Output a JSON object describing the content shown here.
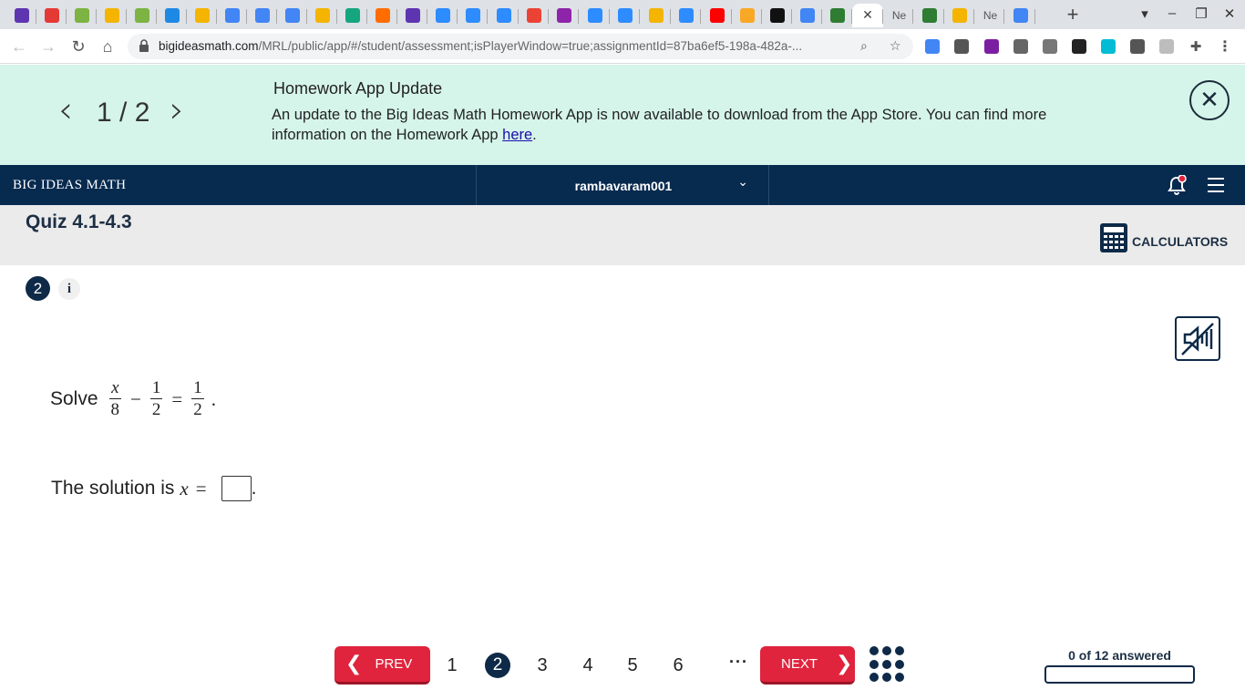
{
  "browser": {
    "tabs": [
      {
        "icon": "list-icon",
        "color": "#5e35b1",
        "label": ""
      },
      {
        "icon": "acrobat-icon",
        "color": "#e53935",
        "label": ""
      },
      {
        "icon": "ixl-icon",
        "color": "#7cb342",
        "label": ""
      },
      {
        "icon": "slides-icon",
        "color": "#f4b400",
        "label": ""
      },
      {
        "icon": "ixl-icon",
        "color": "#7cb342",
        "label": ""
      },
      {
        "icon": "classroom-icon",
        "color": "#1e88e5",
        "label": ""
      },
      {
        "icon": "slides-icon",
        "color": "#f4b400",
        "label": ""
      },
      {
        "icon": "docs-icon",
        "color": "#4285f4",
        "label": ""
      },
      {
        "icon": "docs-icon",
        "color": "#4285f4",
        "label": ""
      },
      {
        "icon": "docs-icon",
        "color": "#4285f4",
        "label": ""
      },
      {
        "icon": "slides-icon",
        "color": "#f4b400",
        "label": ""
      },
      {
        "icon": "grammarly-icon",
        "color": "#15a680",
        "label": ""
      },
      {
        "icon": "f-icon",
        "color": "#ff6d00",
        "label": ""
      },
      {
        "icon": "list-icon",
        "color": "#5e35b1",
        "label": ""
      },
      {
        "icon": "zoom-icon",
        "color": "#2d8cff",
        "label": ""
      },
      {
        "icon": "zoom-icon",
        "color": "#2d8cff",
        "label": ""
      },
      {
        "icon": "zoom-icon",
        "color": "#2d8cff",
        "label": ""
      },
      {
        "icon": "gmail-icon",
        "color": "#ea4335",
        "label": ""
      },
      {
        "icon": "pinwheel-icon",
        "color": "#8e24aa",
        "label": ""
      },
      {
        "icon": "zoom-icon",
        "color": "#2d8cff",
        "label": ""
      },
      {
        "icon": "zoom-icon",
        "color": "#2d8cff",
        "label": ""
      },
      {
        "icon": "classroom-icon",
        "color": "#f4b400",
        "label": ""
      },
      {
        "icon": "zoom-icon",
        "color": "#2d8cff",
        "label": ""
      },
      {
        "icon": "youtube-icon",
        "color": "#ff0000",
        "label": ""
      },
      {
        "icon": "pencil-icon",
        "color": "#f9a825",
        "label": ""
      },
      {
        "icon": "b-icon",
        "color": "#111111",
        "label": ""
      },
      {
        "icon": "google-icon",
        "color": "#4285f4",
        "label": ""
      },
      {
        "icon": "bim-icon",
        "color": "#2e7d32",
        "label": ""
      },
      {
        "icon": "close-icon",
        "color": "#444444",
        "label": ""
      },
      {
        "icon": "new-tab-icon",
        "color": "#9e9e9e",
        "label": "Ne"
      },
      {
        "icon": "bim-icon",
        "color": "#2e7d32",
        "label": ""
      },
      {
        "icon": "classroom-icon",
        "color": "#f4b400",
        "label": ""
      },
      {
        "icon": "new-tab-icon",
        "color": "#9e9e9e",
        "label": "Ne"
      },
      {
        "icon": "google-icon",
        "color": "#4285f4",
        "label": ""
      }
    ],
    "new_tab": "+",
    "url_host": "bigideasmath.com",
    "url_path": "/MRL/public/app/#/student/assessment;isPlayerWindow=true;assignmentId=87ba6ef5-198a-482a-...",
    "extensions": [
      {
        "icon": "translate-icon",
        "color": "#4285f4"
      },
      {
        "icon": "camera-icon",
        "color": "#555555"
      },
      {
        "icon": "puzzle-purple-icon",
        "color": "#7b1fa2"
      },
      {
        "icon": "draw-icon",
        "color": "#666666"
      },
      {
        "icon": "stack-icon",
        "color": "#777777"
      },
      {
        "icon": "spy-icon",
        "color": "#222222"
      },
      {
        "icon": "circle-ext-icon",
        "color": "#00bcd4"
      },
      {
        "icon": "l-icon",
        "color": "#555555"
      },
      {
        "icon": "b-ext-icon",
        "color": "#bdbdbd"
      },
      {
        "icon": "puzzle-icon",
        "color": "#555555"
      },
      {
        "icon": "more-icon",
        "color": "#555555"
      }
    ]
  },
  "banner": {
    "pager": "1 / 2",
    "title": "Homework App Update",
    "body": "An update to the Big Ideas Math Homework App is now available to download from the App Store. You can find more information on the Homework App ",
    "link": "here",
    "tail": ".",
    "bg": "#d6f5ea"
  },
  "appbar": {
    "brand": "BIG IDEAS MATH",
    "username": "rambavaram001",
    "bg": "#072a4f",
    "notification_dot": "#e0243d"
  },
  "quiz": {
    "title": "Quiz 4.1-4.3",
    "calculators_label": "CALCULATORS"
  },
  "question": {
    "number": "2",
    "info_label": "i",
    "solve_label": "Solve",
    "eq": {
      "t1_num": "x",
      "t1_den": "8",
      "op1": "−",
      "t2_num": "1",
      "t2_den": "2",
      "op2": "=",
      "t3_num": "1",
      "t3_den": "2",
      "end": "."
    },
    "answer_prefix": "The solution is",
    "answer_var": "x",
    "answer_eq": "=",
    "answer_value": "",
    "answer_end": "."
  },
  "footer": {
    "prev_label": "PREV",
    "next_label": "NEXT",
    "pages": [
      "1",
      "2",
      "3",
      "4",
      "5",
      "6"
    ],
    "current_page": "2",
    "more_label": "···",
    "progress_label": "0 of 12 answered",
    "answered": 0,
    "total": 12,
    "accent": "#e0243d"
  }
}
